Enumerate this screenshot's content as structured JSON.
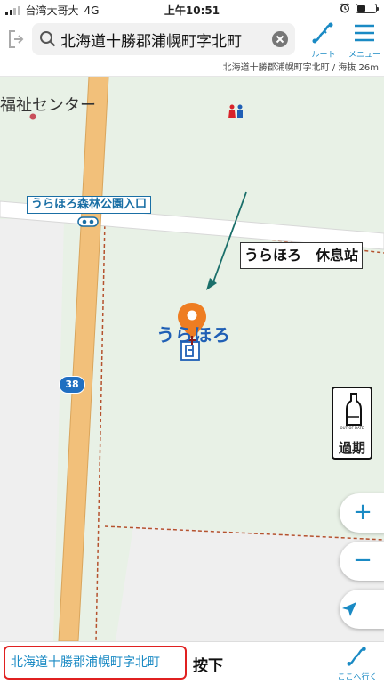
{
  "status": {
    "carrier": "台湾大哥大",
    "network": "4G",
    "time": "上午10:51",
    "battery_level": 0.45
  },
  "header": {
    "search_text": "北海道十勝郡浦幌町字北町",
    "route_label": "ルート",
    "menu_label": "メニュー"
  },
  "info_strip": {
    "location": "北海道十勝郡浦幌町字北町 / 海抜 26m"
  },
  "map": {
    "label_fukushi": "福祉センター",
    "label_park_entrance": "うらほろ森林公園入口",
    "label_place": "うらほろ",
    "callout": "うらほろ　休息站",
    "route_number": "38",
    "outdated_small": "OUT OF DATE",
    "outdated_label": "過期",
    "zoom_in": "+",
    "zoom_out": "−",
    "pin_color": "#ee7d22"
  },
  "bottom": {
    "address": "北海道十勝郡浦幌町字北町",
    "press_label": "按下",
    "goto_label": "ここへ行く"
  },
  "colors": {
    "accent": "#1a8ac4",
    "map_green": "#e8f1e6",
    "road_orange": "#f2c07a",
    "highlight_red": "#e02020"
  }
}
